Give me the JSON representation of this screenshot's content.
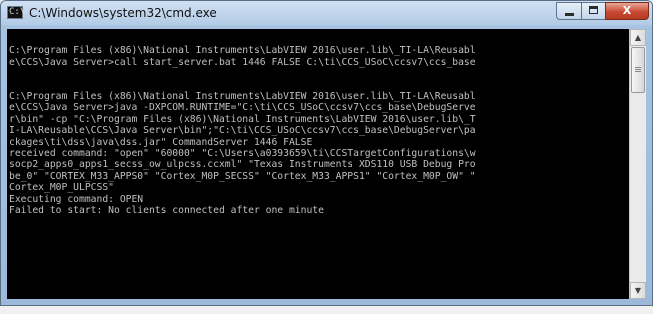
{
  "window": {
    "title": "C:\\Windows\\system32\\cmd.exe",
    "icon": "cmd-icon",
    "controls": {
      "minimize": "minimize-icon",
      "maximize": "maximize-icon",
      "close": "close-icon",
      "close_label": "X"
    }
  },
  "console": {
    "lines": [
      "",
      "C:\\Program Files (x86)\\National Instruments\\LabVIEW 2016\\user.lib\\_TI-LA\\Reusabl",
      "e\\CCS\\Java Server>call start_server.bat 1446 FALSE C:\\ti\\CCS_USoC\\ccsv7\\ccs_base",
      "",
      "",
      "C:\\Program Files (x86)\\National Instruments\\LabVIEW 2016\\user.lib\\_TI-LA\\Reusabl",
      "e\\CCS\\Java Server>java -DXPCOM.RUNTIME=\"C:\\ti\\CCS_USoC\\ccsv7\\ccs_base\\DebugServe",
      "r\\bin\" -cp \"C:\\Program Files (x86)\\National Instruments\\LabVIEW 2016\\user.lib\\_T",
      "I-LA\\Reusable\\CCS\\Java Server\\bin\";\"C:\\ti\\CCS_USoC\\ccsv7\\ccs_base\\DebugServer\\pa",
      "ckages\\ti\\dss\\java\\dss.jar\" CommandServer 1446 FALSE",
      "received command: \"open\" \"60000\" \"C:\\Users\\a0393659\\ti\\CCSTargetConfigurations\\w",
      "socp2_apps0_apps1_secss_ow_ulpcss.ccxml\" \"Texas Instruments XDS110 USB Debug Pro",
      "be_0\" \"CORTEX_M33_APPS0\" \"Cortex_M0P_SECSS\" \"Cortex_M33_APPS1\" \"Cortex_M0P_OW\" \"",
      "Cortex_M0P_ULPCSS\"",
      "Executing command: OPEN",
      "Failed to start: No clients connected after one minute"
    ]
  },
  "scrollbar": {
    "up_arrow": "▲",
    "down_arrow": "▼"
  }
}
